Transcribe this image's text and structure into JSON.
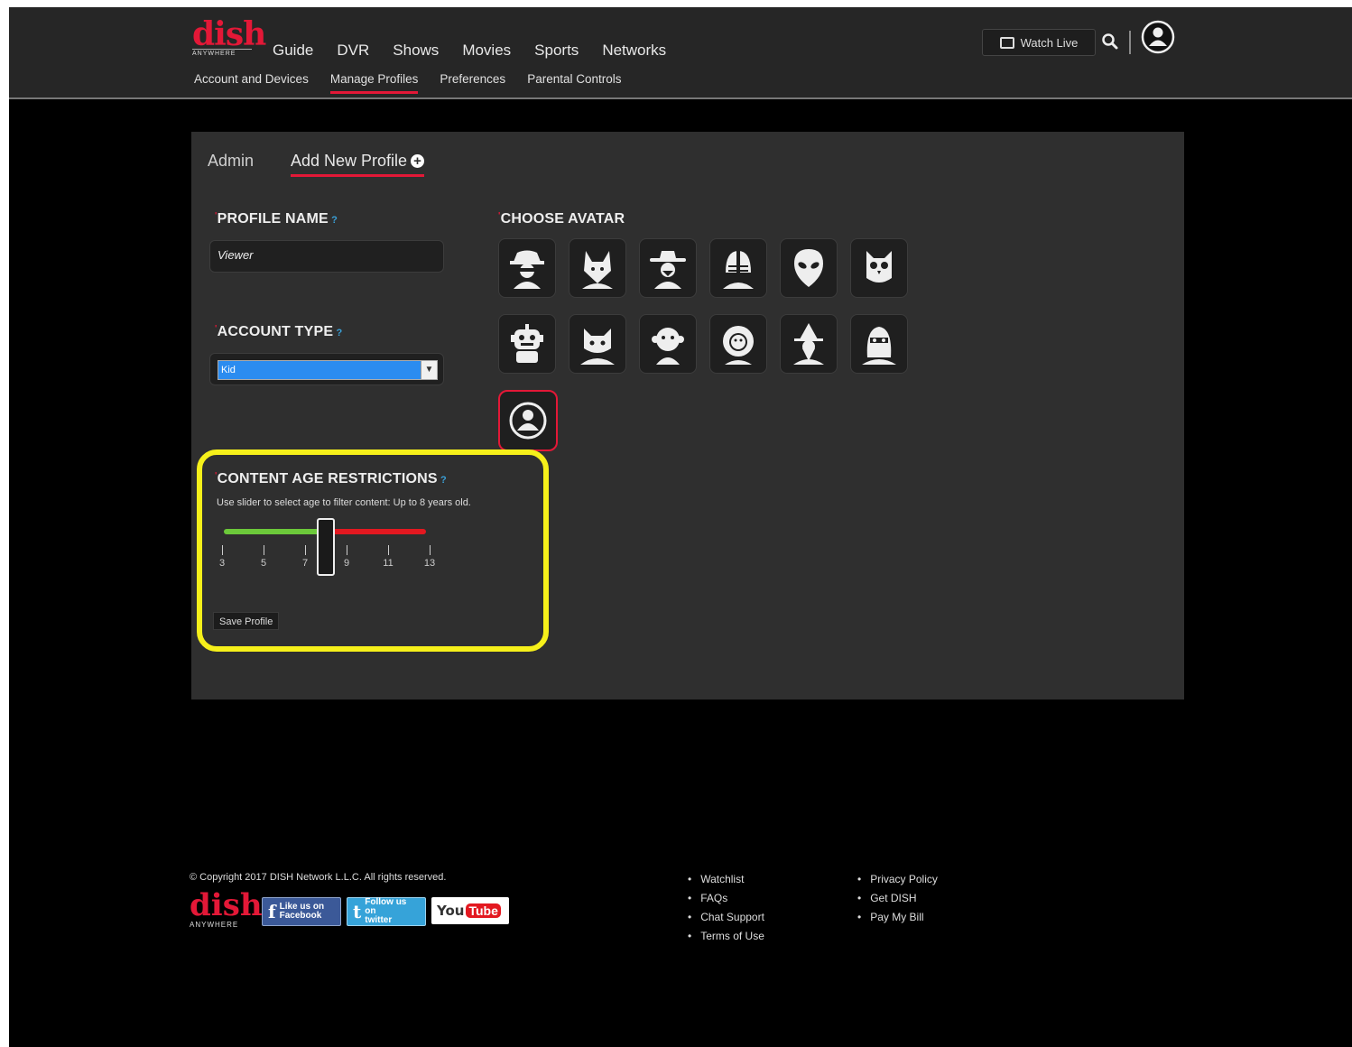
{
  "brand": {
    "logo_text": "dish",
    "logo_subtext": "ANYWHERE"
  },
  "nav": {
    "main": [
      "Guide",
      "DVR",
      "Shows",
      "Movies",
      "Sports",
      "Networks"
    ],
    "sub": [
      "Account and Devices",
      "Manage Profiles",
      "Preferences",
      "Parental Controls"
    ],
    "active_sub": "Manage Profiles",
    "watch_live": "Watch Live"
  },
  "tabs": {
    "admin": "Admin",
    "add_new": "Add New Profile"
  },
  "form": {
    "profile_name_label": "PROFILE NAME",
    "profile_name_value": "Viewer",
    "account_type_label": "ACCOUNT TYPE",
    "account_type_value": "Kid",
    "choose_avatar_label": "CHOOSE AVATAR",
    "avatars": [
      "spy",
      "wolf",
      "cowboy",
      "football-player",
      "alien",
      "owl",
      "robot",
      "cat",
      "monkey",
      "lion",
      "wizard",
      "superhero",
      "default-user"
    ],
    "selected_avatar": "default-user",
    "restrictions_label": "CONTENT AGE RESTRICTIONS",
    "restrictions_desc": "Use slider to select age to filter content: Up to 8 years old.",
    "slider_ticks": [
      "3",
      "5",
      "7",
      "9",
      "11",
      "13"
    ],
    "slider_value": 8,
    "save_button": "Save Profile"
  },
  "footer": {
    "copyright": "© Copyright 2017 DISH Network L.L.C. All rights reserved.",
    "logo_text": "dish",
    "logo_subtext": "ANYWHERE",
    "social": {
      "facebook": [
        "Like us on",
        "Facebook"
      ],
      "twitter": [
        "Follow us on",
        "twitter"
      ],
      "youtube": [
        "You",
        "Tube"
      ]
    },
    "links_col1": [
      "Watchlist",
      "FAQs",
      "Chat Support",
      "Terms of Use"
    ],
    "links_col2": [
      "Privacy Policy",
      "Get DISH",
      "Pay My Bill"
    ]
  },
  "colors": {
    "accent": "#e31837",
    "highlight": "#f6f01a",
    "slider_green": "#6cc93a",
    "slider_red": "#e31820",
    "select_blue": "#2b8cf0"
  }
}
